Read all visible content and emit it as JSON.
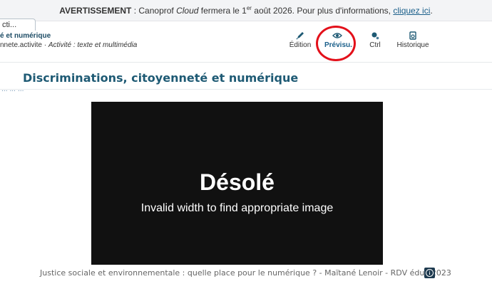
{
  "banner": {
    "label": "AVERTISSEMENT",
    "sep": " : ",
    "pre": "Canoprof ",
    "brand": "Cloud",
    "mid": " fermera le 1",
    "sup": "er",
    "post": " août 2026. Pour plus d'informations, ",
    "link": "cliquez ici",
    "end": "."
  },
  "tab": {
    "label": "cti..."
  },
  "subheader": {
    "title": "é et numérique",
    "path_id": "nnete.activite",
    "path_sep": " · ",
    "path_type": "Activité : texte et multimédia"
  },
  "toolbar": [
    {
      "label": "Édition",
      "icon": "pen-icon"
    },
    {
      "label": "Prévisu.",
      "icon": "eye-icon",
      "active": true
    },
    {
      "label": "Ctrl",
      "icon": "ctrl-icon"
    },
    {
      "label": "Historique",
      "icon": "history-icon"
    }
  ],
  "page": {
    "title": "Discriminations, citoyenneté et numérique",
    "clipped_text": "... ... ..."
  },
  "video": {
    "error_title": "Désolé",
    "error_message": "Invalid width to find appropriate image"
  },
  "caption": "Justice sociale et environnementale : quelle place pour le numérique ? - Maïtané Lenoir - RDV éduc 2023",
  "bottom_cut_text": "...   ...   ......   ......",
  "colors": {
    "accent": "#1e5a74",
    "link": "#1a5f8a",
    "highlight": "#e3101a",
    "video_bg": "#111111"
  }
}
